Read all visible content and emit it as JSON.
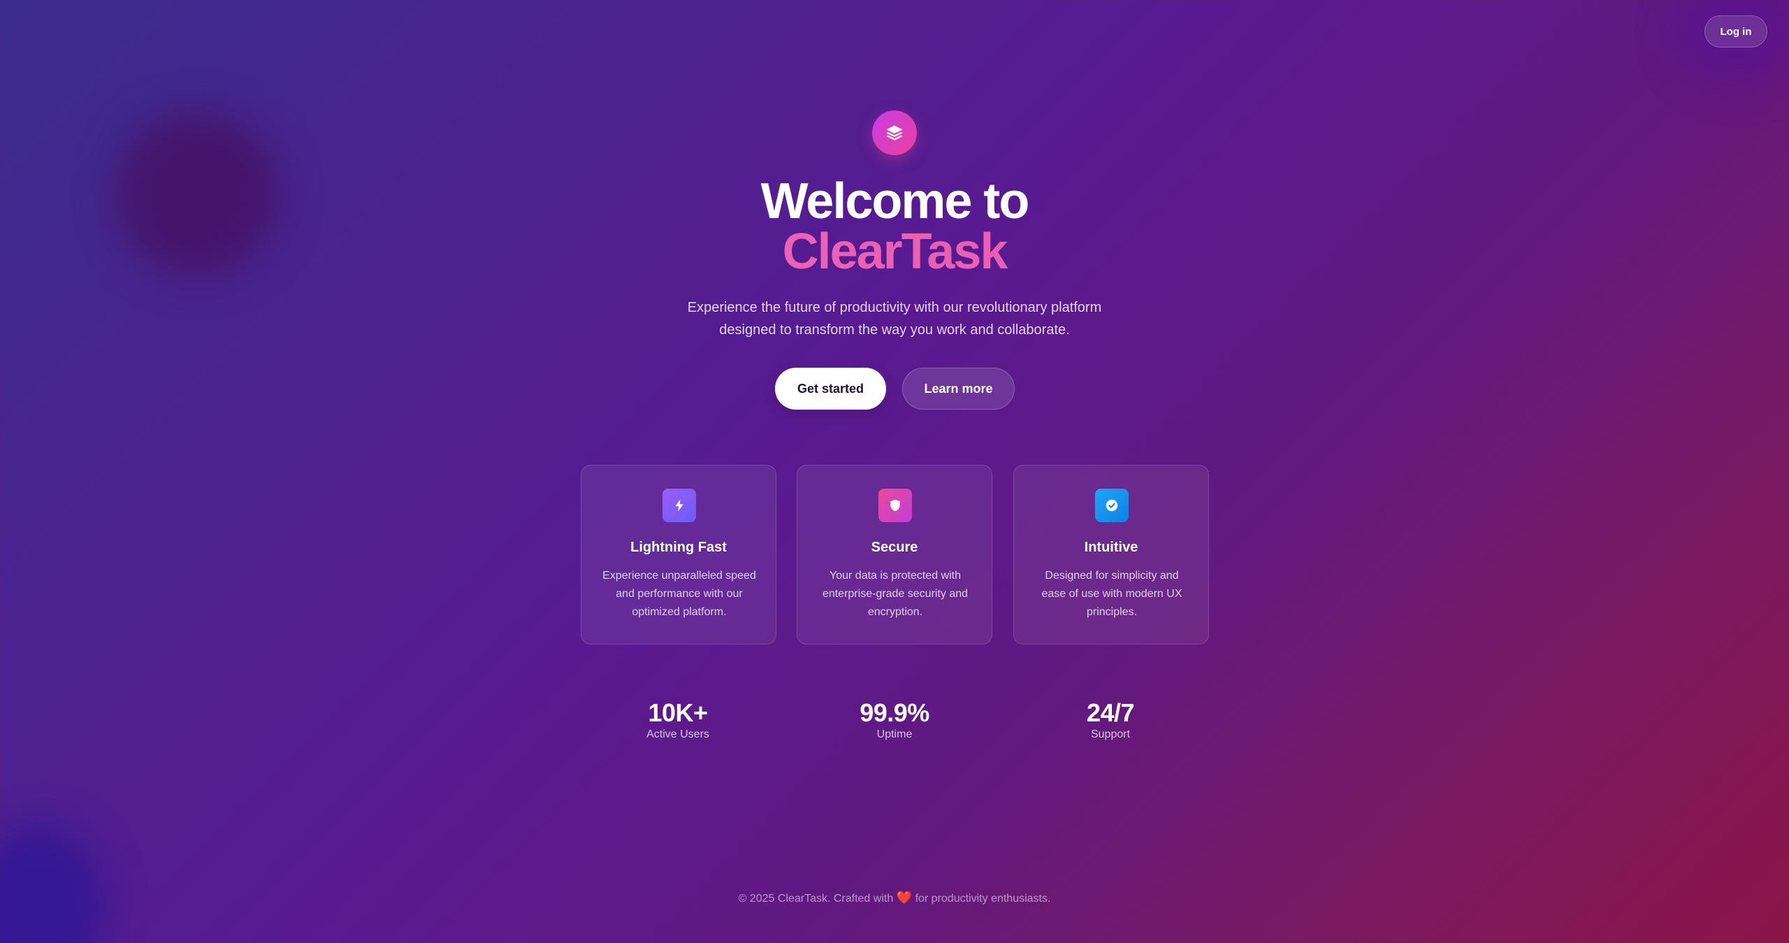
{
  "header": {
    "login_label": "Log in"
  },
  "hero": {
    "logo_icon": "layers-icon",
    "title_line1": "Welcome to",
    "title_line2": "ClearTask",
    "subtitle_line1": "Experience the future of productivity with our revolutionary platform",
    "subtitle_line2": "designed to transform the way you work and collaborate.",
    "primary_cta": "Get started",
    "secondary_cta": "Learn more"
  },
  "features": [
    {
      "icon": "lightning-icon",
      "title": "Lightning Fast",
      "description": "Experience unparalleled speed and performance with our optimized platform."
    },
    {
      "icon": "shield-icon",
      "title": "Secure",
      "description": "Your data is protected with enterprise-grade security and encryption."
    },
    {
      "icon": "check-badge-icon",
      "title": "Intuitive",
      "description": "Designed for simplicity and ease of use with modern UX principles."
    }
  ],
  "stats": [
    {
      "value": "10K+",
      "label": "Active Users"
    },
    {
      "value": "99.9%",
      "label": "Uptime"
    },
    {
      "value": "24/7",
      "label": "Support"
    }
  ],
  "footer": {
    "text_before": "© 2025 ClearTask. Crafted with",
    "heart": "❤️",
    "text_after": "for productivity enthusiasts."
  },
  "colors": {
    "accent_pink": "#ec4899",
    "accent_purple": "#9b5cf6",
    "accent_blue": "#1ea7f5",
    "background_start": "#3a2c8c",
    "background_end": "#8c1548"
  }
}
